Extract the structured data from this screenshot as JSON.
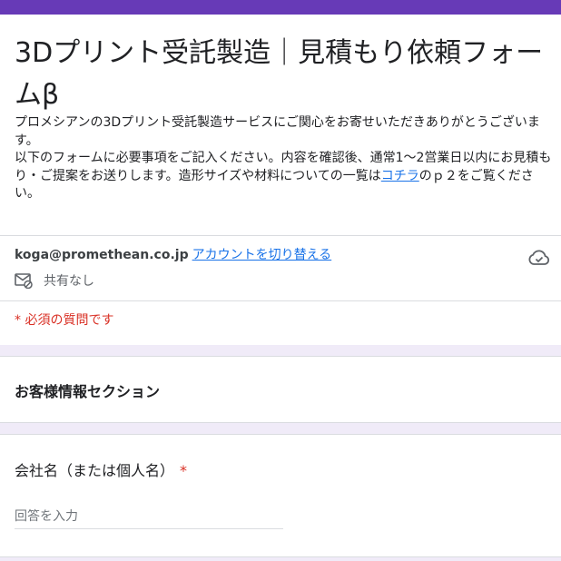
{
  "form": {
    "title": "3Dプリント受託製造｜見積もり依頼フォームβ",
    "description_line1": "プロメシアンの3Dプリント受託製造サービスにご関心をお寄せいただきありがとうございます。",
    "description_line2_prefix": "以下のフォームに必要事項をご記入ください。内容を確認後、通常1〜2営業日以内にお見積もり・ご提案をお送りします。造形サイズや材料についての一覧は",
    "description_link": "コチラ",
    "description_line2_suffix": "のｐ２をご覧ください。"
  },
  "account": {
    "email": "koga@promethean.co.jp",
    "switch_label": "アカウントを切り替える",
    "share_status": "共有なし"
  },
  "required_note": "* 必須の質問です",
  "sections": {
    "customer_title": "お客様情報セクション"
  },
  "questions": [
    {
      "label": "会社名（または個人名）",
      "required_mark": "*",
      "placeholder": "回答を入力"
    }
  ],
  "colors": {
    "accent": "#673ab7",
    "background": "#f0ebf8",
    "link": "#1a73e8",
    "required": "#d93025"
  },
  "icons": {
    "cloud": "cloud-check-icon",
    "mail": "mail-off-icon"
  }
}
